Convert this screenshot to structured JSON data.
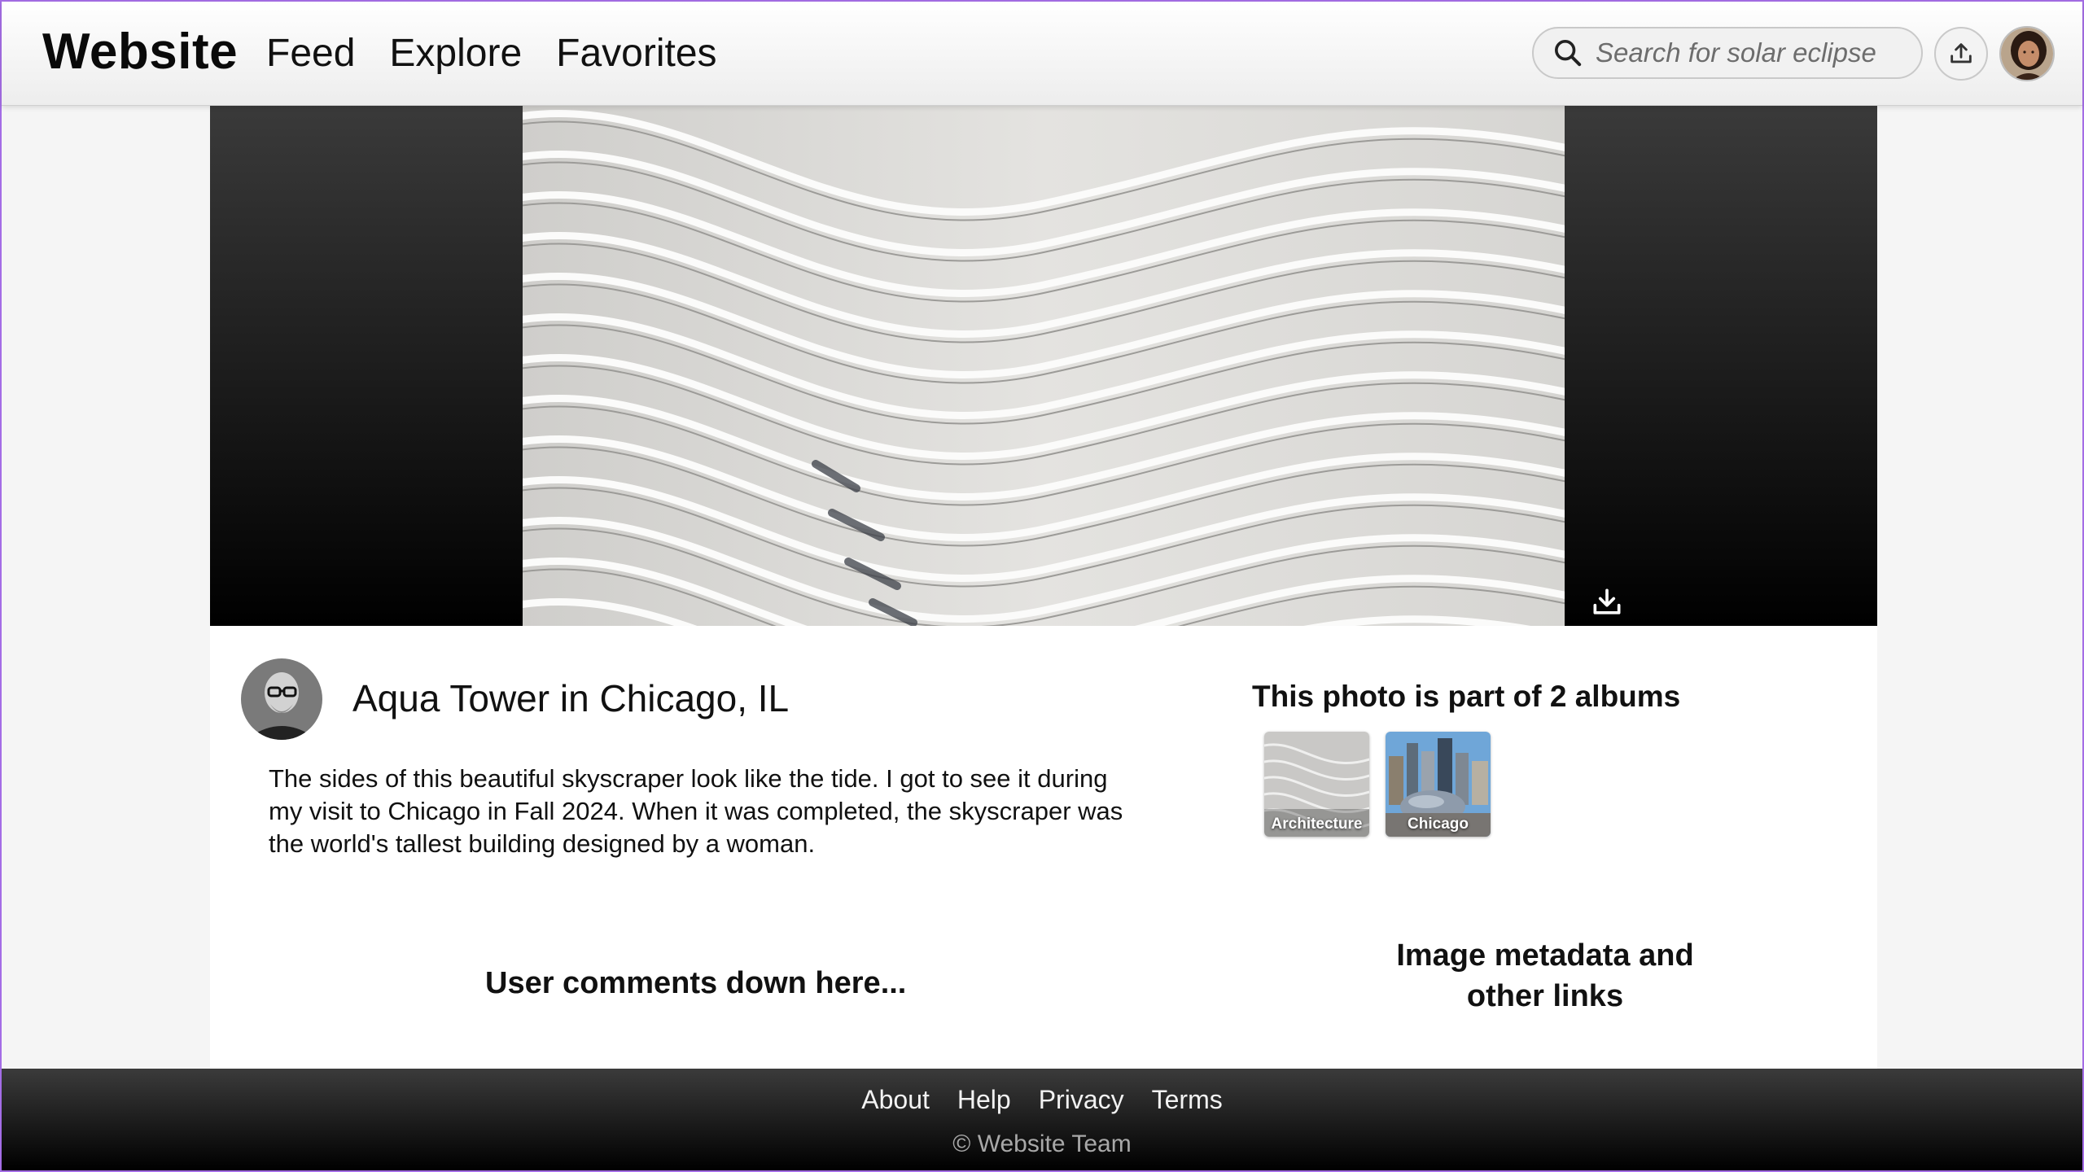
{
  "header": {
    "brand": "Website",
    "nav": [
      "Feed",
      "Explore",
      "Favorites"
    ],
    "search_placeholder": "Search for solar eclipse"
  },
  "photo": {
    "title": "Aqua Tower in Chicago, IL",
    "description": "The sides of this beautiful skyscraper look like the tide. I got to see it during my visit to Chicago in Fall 2024. When it was completed, the skyscraper was the world's tallest building designed by a woman."
  },
  "albums": {
    "heading": "This photo is part of 2 albums",
    "items": [
      {
        "label": "Architecture"
      },
      {
        "label": "Chicago"
      }
    ]
  },
  "placeholders": {
    "comments": "User comments down here...",
    "metadata": "Image metadata and other links"
  },
  "footer": {
    "links": [
      "About",
      "Help",
      "Privacy",
      "Terms"
    ],
    "copyright": "© Website Team"
  },
  "icons": {
    "search": "search-icon",
    "upload": "upload-icon",
    "download": "download-icon"
  },
  "colors": {
    "window_border": "#a46de6",
    "footer_bg": "#000000",
    "hero_bg": "#1a1a1a"
  }
}
